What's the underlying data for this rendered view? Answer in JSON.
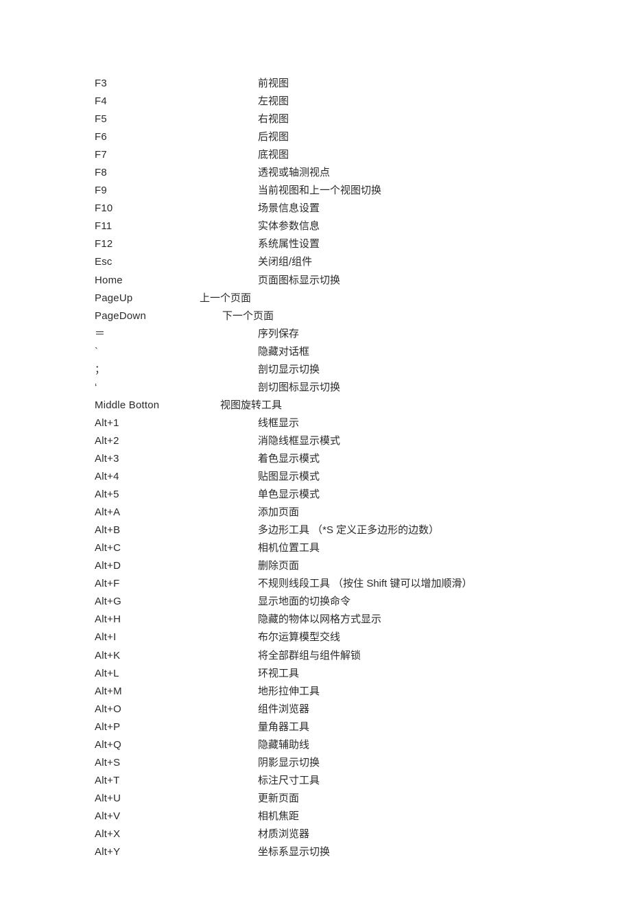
{
  "shortcuts": [
    {
      "key": "F3",
      "desc": "前视图"
    },
    {
      "key": "F4",
      "desc": "左视图"
    },
    {
      "key": "F5",
      "desc": "右视图"
    },
    {
      "key": "F6",
      "desc": "后视图"
    },
    {
      "key": "F7",
      "desc": "底视图"
    },
    {
      "key": "F8",
      "desc": "透视或轴测视点"
    },
    {
      "key": "F9",
      "desc": "当前视图和上一个视图切换"
    },
    {
      "key": "F10",
      "desc": "场景信息设置"
    },
    {
      "key": "F11",
      "desc": "实体参数信息"
    },
    {
      "key": "F12",
      "desc": "系统属性设置"
    },
    {
      "key": "Esc",
      "desc": "关闭组/组件"
    },
    {
      "key": "Home",
      "desc": "页面图标显示切换"
    },
    {
      "key": "PageUp",
      "desc": "上一个页面",
      "indent": -85
    },
    {
      "key": "PageDown",
      "desc": "下一个页面",
      "indent": -52
    },
    {
      "key": "＝",
      "desc": "    序列保存"
    },
    {
      "key": "`",
      "desc": "    隐藏对话框"
    },
    {
      "key": "；",
      "desc": "       剖切显示切换"
    },
    {
      "key": "‘",
      "desc": "    剖切图标显示切换"
    },
    {
      "key": "Middle Botton",
      "desc": "视图旋转工具",
      "indent": -55
    },
    {
      "key": "Alt+1",
      "desc": "    线框显示"
    },
    {
      "key": "Alt+2",
      "desc": "消隐线框显示模式"
    },
    {
      "key": "Alt+3",
      "desc": "着色显示模式"
    },
    {
      "key": "Alt+4",
      "desc": "贴图显示模式"
    },
    {
      "key": "Alt+5",
      "desc": "单色显示模式"
    },
    {
      "key": "Alt+A",
      "desc": "添加页面"
    },
    {
      "key": "Alt+B",
      "desc": "多边形工具  （*S 定义正多边形的边数）"
    },
    {
      "key": "Alt+C",
      "desc": "相机位置工具"
    },
    {
      "key": "Alt+D",
      "desc": "删除页面"
    },
    {
      "key": "Alt+F",
      "desc": "不规则线段工具  （按住 Shift 键可以增加顺滑）"
    },
    {
      "key": "Alt+G",
      "desc": "显示地面的切换命令"
    },
    {
      "key": "Alt+H",
      "desc": "  隐藏的物体以网格方式显示"
    },
    {
      "key": "Alt+I",
      "desc": "  布尔运算模型交线"
    },
    {
      "key": "Alt+K",
      "desc": "将全部群组与组件解锁"
    },
    {
      "key": "Alt+L",
      "desc": "环视工具"
    },
    {
      "key": "Alt+M",
      "desc": "地形拉伸工具"
    },
    {
      "key": "Alt+O",
      "desc": "组件浏览器"
    },
    {
      "key": "Alt+P",
      "desc": "  量角器工具"
    },
    {
      "key": "Alt+Q",
      "desc": "  隐藏辅助线"
    },
    {
      "key": "Alt+S",
      "desc": "阴影显示切换"
    },
    {
      "key": "Alt+T",
      "desc": "标注尺寸工具"
    },
    {
      "key": "Alt+U",
      "desc": "更新页面"
    },
    {
      "key": "Alt+V",
      "desc": "相机焦距"
    },
    {
      "key": "Alt+X",
      "desc": "材质浏览器"
    },
    {
      "key": "Alt+Y",
      "desc": "坐标系显示切换"
    }
  ]
}
